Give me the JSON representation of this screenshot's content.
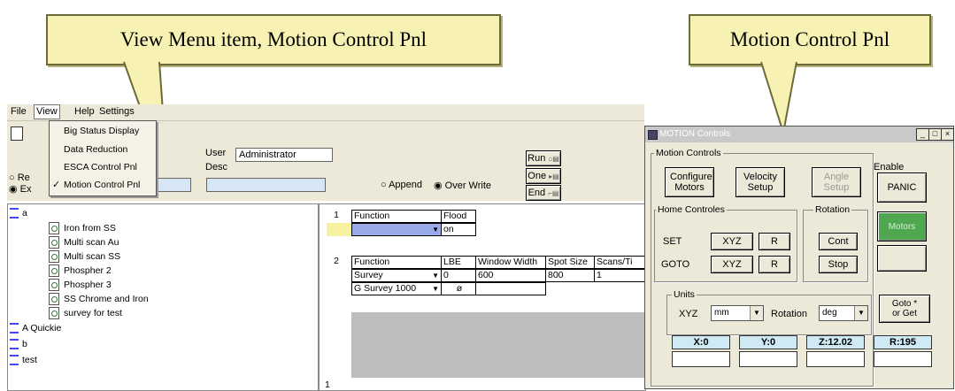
{
  "callouts": {
    "left": "View Menu item, Motion Control Pnl",
    "right": "Motion Control Pnl"
  },
  "menubar": {
    "file": "File",
    "view": "View",
    "help": "Help",
    "settings": "Settings"
  },
  "view_menu": {
    "items": [
      "Big Status Display",
      "Data Reduction",
      "ESCA Control Pnl",
      "Motion Control Pnl"
    ],
    "checked_item": "Motion Control Pnl"
  },
  "header": {
    "user_label": "User",
    "user_value": "Administrator",
    "desc_label": "Desc",
    "radio_re": "Re",
    "radio_ex": "Ex",
    "append_label": "Append",
    "overwrite_label": "Over Write"
  },
  "run_buttons": {
    "run": "Run",
    "one": "One",
    "end": "End"
  },
  "tree": {
    "root": "a",
    "children": [
      "Iron from SS",
      "Multi scan Au",
      "Multi scan SS",
      "Phospher 2",
      "Phospher 3",
      "SS Chrome and Iron",
      "survey for test"
    ],
    "other_roots": [
      "A Quickie",
      "b",
      "test"
    ]
  },
  "grid": {
    "row1": {
      "num": "1",
      "col_function": "Function",
      "col_flood": "Flood",
      "function_value": "",
      "flood_value": "on"
    },
    "row2": {
      "num": "2",
      "headers": [
        "Function",
        "LBE",
        "Window Width",
        "Spot Size",
        "Scans/Ti"
      ],
      "rows": [
        [
          "Survey",
          "0",
          "600",
          "800",
          "1"
        ],
        [
          "G Survey 1000",
          "",
          "",
          "",
          ""
        ]
      ]
    },
    "footer_num": "1"
  },
  "motion": {
    "title": "MOTION Controls",
    "group_label": "Motion Controls",
    "configure": "Configure Motors",
    "velocity": "Velocity Setup",
    "angle": "Angle Setup",
    "enable_label": "Enable",
    "panic": "PANIC",
    "motors": "Motors",
    "home_label": "Home Controles",
    "rotation_label": "Rotation",
    "set": "SET",
    "goto": "GOTO",
    "xyz": "XYZ",
    "r": "R",
    "cont": "Cont",
    "stop": "Stop",
    "units_label": "Units",
    "xyz_units_label": "XYZ",
    "xyz_unit": "mm",
    "rotation_units_label": "Rotation",
    "rotation_unit": "deg",
    "goto_get": "Goto * or Get",
    "readouts": [
      "X:0",
      "Y:0",
      "Z:12.02",
      "R:195"
    ],
    "colors": {
      "motors_btn": "#4fa84f",
      "readout_bg": "#cfe9f5"
    }
  }
}
